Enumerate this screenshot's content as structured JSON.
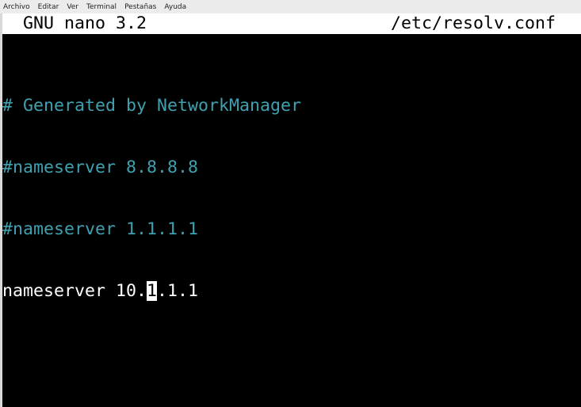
{
  "menubar": {
    "items": [
      "Archivo",
      "Editar",
      "Ver",
      "Terminal",
      "Pestañas",
      "Ayuda"
    ]
  },
  "nano": {
    "app_version": "GNU nano 3.2",
    "file_name": "/etc/resolv.conf"
  },
  "editor": {
    "lines": [
      "# Generated by NetworkManager",
      "#nameserver 8.8.8.8",
      "#nameserver 1.1.1.1"
    ],
    "active_line": {
      "before_cursor": "nameserver 10.",
      "cursor_char": "1",
      "after_cursor": ".1.1"
    }
  },
  "colors": {
    "comment": "#3fa0b0",
    "text": "#ffffff",
    "background": "#000000",
    "titlebar_bg": "#ffffff"
  }
}
